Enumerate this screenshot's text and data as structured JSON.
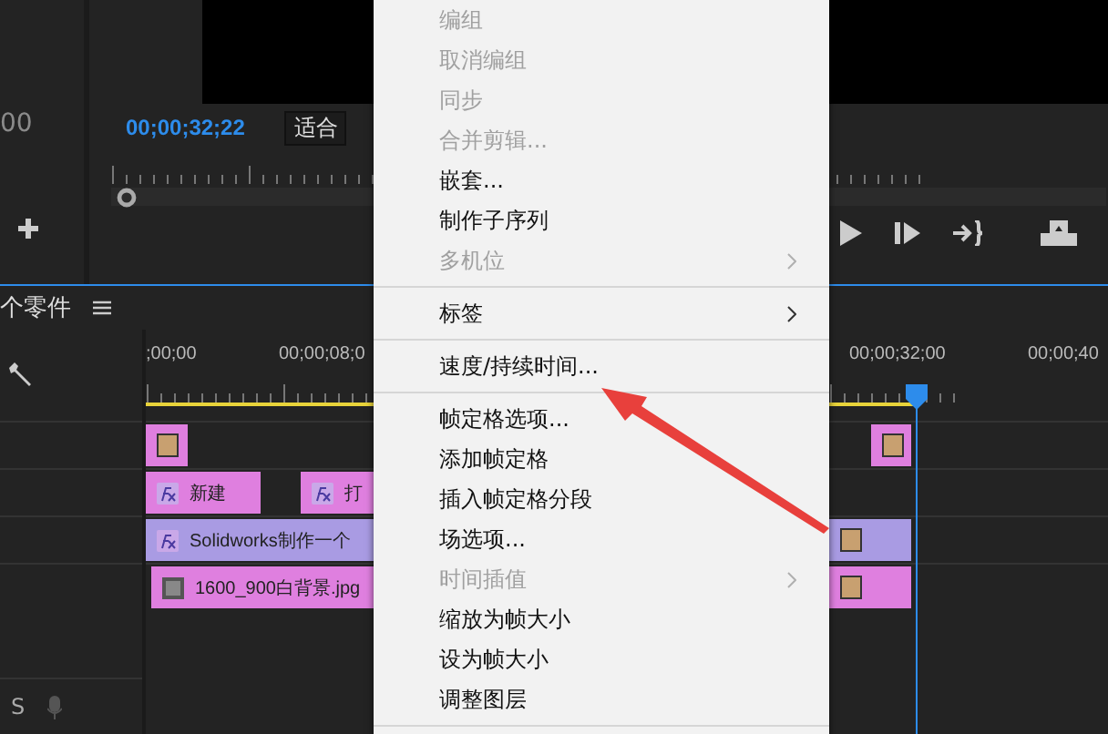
{
  "source_panel": {
    "timecode": "00"
  },
  "program_monitor": {
    "timecode": "00;00;32;22",
    "fit_dropdown": "适合"
  },
  "timeline": {
    "title": "个零件",
    "ruler_labels": [
      ";00;00",
      "00;00;08;0",
      "00;00;32;00",
      "00;00;40"
    ],
    "track_label": "S",
    "tracks": [
      {
        "clips": [
          {
            "kind": "title",
            "color": "#df7fdf"
          },
          {
            "kind": "title",
            "color": "#df7fdf"
          }
        ]
      },
      {
        "clips": [
          {
            "kind": "fx",
            "color": "#df7fdf",
            "label": "新建"
          },
          {
            "kind": "fx",
            "color": "#df7fdf",
            "label": "打"
          }
        ]
      },
      {
        "clips": [
          {
            "kind": "fx",
            "color": "#a99be3",
            "label": "Solidworks制作一个"
          },
          {
            "kind": "title",
            "color": "#a99be3"
          }
        ]
      },
      {
        "clips": [
          {
            "kind": "image",
            "color": "#df7fdf",
            "label": "1600_900白背景.jpg"
          },
          {
            "kind": "title",
            "color": "#df7fdf"
          }
        ]
      }
    ]
  },
  "context_menu": [
    {
      "kind": "item",
      "label": "编组",
      "disabled": true,
      "submenu": false
    },
    {
      "kind": "item",
      "label": "取消编组",
      "disabled": true,
      "submenu": false
    },
    {
      "kind": "item",
      "label": "同步",
      "disabled": true,
      "submenu": false
    },
    {
      "kind": "item",
      "label": "合并剪辑...",
      "disabled": true,
      "submenu": false
    },
    {
      "kind": "item",
      "label": "嵌套...",
      "disabled": false,
      "submenu": false
    },
    {
      "kind": "item",
      "label": "制作子序列",
      "disabled": false,
      "submenu": false
    },
    {
      "kind": "item",
      "label": "多机位",
      "disabled": true,
      "submenu": true
    },
    {
      "kind": "separator"
    },
    {
      "kind": "item",
      "label": "标签",
      "disabled": false,
      "submenu": true
    },
    {
      "kind": "separator"
    },
    {
      "kind": "item",
      "label": "速度/持续时间...",
      "disabled": false,
      "submenu": false
    },
    {
      "kind": "separator"
    },
    {
      "kind": "item",
      "label": "帧定格选项...",
      "disabled": false,
      "submenu": false
    },
    {
      "kind": "item",
      "label": "添加帧定格",
      "disabled": false,
      "submenu": false
    },
    {
      "kind": "item",
      "label": "插入帧定格分段",
      "disabled": false,
      "submenu": false
    },
    {
      "kind": "item",
      "label": "场选项...",
      "disabled": false,
      "submenu": false
    },
    {
      "kind": "item",
      "label": "时间插值",
      "disabled": true,
      "submenu": true
    },
    {
      "kind": "item",
      "label": "缩放为帧大小",
      "disabled": false,
      "submenu": false
    },
    {
      "kind": "item",
      "label": "设为帧大小",
      "disabled": false,
      "submenu": false
    },
    {
      "kind": "item",
      "label": "调整图层",
      "disabled": false,
      "submenu": false
    },
    {
      "kind": "separator"
    }
  ]
}
